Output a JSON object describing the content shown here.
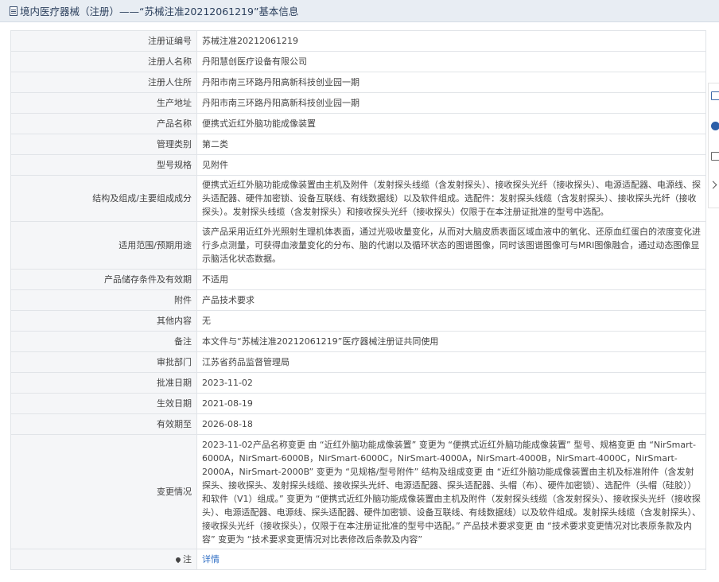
{
  "header": {
    "title": "境内医疗器械（注册）——“苏械注准20212061219”基本信息"
  },
  "rows": [
    {
      "label": "注册证编号",
      "value": "苏械注准20212061219"
    },
    {
      "label": "注册人名称",
      "value": "丹阳慧创医疗设备有限公司"
    },
    {
      "label": "注册人住所",
      "value": "丹阳市南三环路丹阳高新科技创业园一期"
    },
    {
      "label": "生产地址",
      "value": "丹阳市南三环路丹阳高新科技创业园一期"
    },
    {
      "label": "产品名称",
      "value": "便携式近红外脑功能成像装置"
    },
    {
      "label": "管理类别",
      "value": "第二类"
    },
    {
      "label": "型号规格",
      "value": "见附件"
    },
    {
      "label": "结构及组成/主要组成成分",
      "value": "便携式近红外脑功能成像装置由主机及附件（发射探头线缆（含发射探头）、接收探头光纤（接收探头）、电源适配器、电源线、探头适配器、硬件加密锁、设备互联线、有线数据线）以及软件组成。选配件：发射探头线缆（含发射探头）、接收探头光纤（接收探头）。发射探头线缆（含发射探头）和接收探头光纤（接收探头）仅限于在本注册证批准的型号中选配。"
    },
    {
      "label": "适用范围/预期用途",
      "value": "该产品采用近红外光照射生理机体表面，通过光吸收量变化，从而对大脑皮质表面区域血液中的氧化、还原血红蛋白的浓度变化进行多点测量，可获得血液量变化的分布、脑的代谢以及循环状态的图谱图像，同时该图谱图像可与MRI图像融合，通过动态图像显示脑活化状态数据。"
    },
    {
      "label": "产品储存条件及有效期",
      "value": "不适用"
    },
    {
      "label": "附件",
      "value": "产品技术要求"
    },
    {
      "label": "其他内容",
      "value": "无"
    },
    {
      "label": "备注",
      "value": "本文件与“苏械注准20212061219”医疗器械注册证共同使用"
    },
    {
      "label": "审批部门",
      "value": "江苏省药品监督管理局"
    },
    {
      "label": "批准日期",
      "value": "2023-11-02"
    },
    {
      "label": "生效日期",
      "value": "2021-08-19"
    },
    {
      "label": "有效期至",
      "value": "2026-08-18"
    },
    {
      "label": "变更情况",
      "value": "2023-11-02产品名称变更 由 “近红外脑功能成像装置” 变更为 “便携式近红外脑功能成像装置” 型号、规格变更 由 “NirSmart-6000A，NirSmart-6000B，NirSmart-6000C，NirSmart-4000A，NirSmart-4000B，NirSmart-4000C，NirSmart-2000A，NirSmart-2000B” 变更为 “见规格/型号附件” 结构及组成变更 由 “近红外脑功能成像装置由主机及标准附件（含发射探头、接收探头、发射探头线缆、接收探头光纤、电源适配器、探头适配器、头帽（布）、硬件加密锁）、选配件（头帽（硅胶））和软件（V1）组成。” 变更为 “便携式近红外脑功能成像装置由主机及附件（发射探头线缆（含发射探头）、接收探头光纤（接收探头）、电源适配器、电源线、探头适配器、硬件加密锁、设备互联线、有线数据线）以及软件组成。发射探头线缆（含发射探头）、接收探头光纤（接收探头），仅限于在本注册证批准的型号中选配。” 产品技术要求变更 由 “技术要求变更情况对比表原条款及内容” 变更为 “技术要求变更情况对比表修改后条款及内容”"
    }
  ],
  "note_row": {
    "label": "注",
    "link": "详情"
  },
  "side_tools": [
    "edit-icon",
    "help-icon",
    "copy-icon",
    "collapse-icon"
  ]
}
